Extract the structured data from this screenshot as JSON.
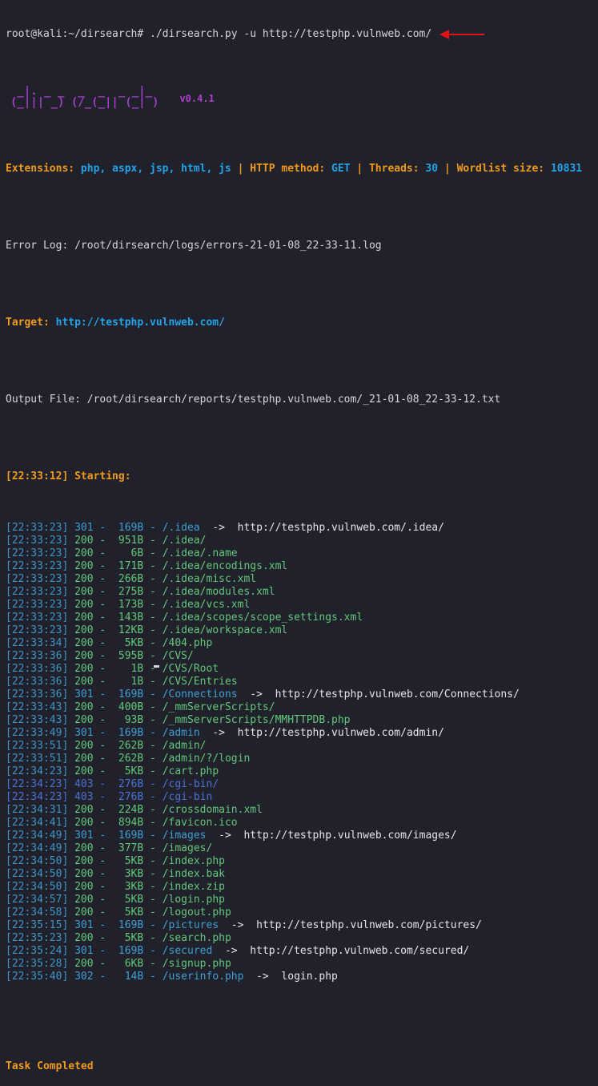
{
  "prompt": "root@kali:~/dirsearch#",
  "command": "./dirsearch.py -u http://testphp.vulnweb.com/",
  "logo_art": [
    " _|. _ _  _  _  _ _|_",
    "(_||| _) (/_(_|| (_| )"
  ],
  "version": "v0.4.1",
  "config": {
    "ext_label": "Extensions:",
    "ext_value": "php, aspx, jsp, html, js",
    "sep": "|",
    "method_label": "HTTP method:",
    "method_value": "GET",
    "threads_label": "Threads:",
    "threads_value": "30",
    "wordlist_label": "Wordlist size:",
    "wordlist_value": "10831"
  },
  "error_log": "Error Log: /root/dirsearch/logs/errors-21-01-08_22-33-11.log",
  "target_label": "Target:",
  "target_url": "http://testphp.vulnweb.com/",
  "output_file": "Output File: /root/dirsearch/reports/testphp.vulnweb.com/_21-01-08_22-33-12.txt",
  "start_line": "[22:33:12] Starting:",
  "arrow": "->",
  "dash": "-",
  "results": [
    {
      "time": "[22:33:23]",
      "status": "301",
      "size": "169B",
      "path": "/.idea",
      "redirect": "http://testphp.vulnweb.com/.idea/"
    },
    {
      "time": "[22:33:23]",
      "status": "200",
      "size": "951B",
      "path": "/.idea/"
    },
    {
      "time": "[22:33:23]",
      "status": "200",
      "size": "6B",
      "path": "/.idea/.name"
    },
    {
      "time": "[22:33:23]",
      "status": "200",
      "size": "171B",
      "path": "/.idea/encodings.xml"
    },
    {
      "time": "[22:33:23]",
      "status": "200",
      "size": "266B",
      "path": "/.idea/misc.xml"
    },
    {
      "time": "[22:33:23]",
      "status": "200",
      "size": "275B",
      "path": "/.idea/modules.xml"
    },
    {
      "time": "[22:33:23]",
      "status": "200",
      "size": "173B",
      "path": "/.idea/vcs.xml"
    },
    {
      "time": "[22:33:23]",
      "status": "200",
      "size": "143B",
      "path": "/.idea/scopes/scope_settings.xml"
    },
    {
      "time": "[22:33:23]",
      "status": "200",
      "size": "12KB",
      "path": "/.idea/workspace.xml"
    },
    {
      "time": "[22:33:34]",
      "status": "200",
      "size": "5KB",
      "path": "/404.php"
    },
    {
      "time": "[22:33:36]",
      "status": "200",
      "size": "595B",
      "path": "/CVS/"
    },
    {
      "time": "[22:33:36]",
      "status": "200",
      "size": "1B",
      "path": "/CVS/Root"
    },
    {
      "time": "[22:33:36]",
      "status": "200",
      "size": "1B",
      "path": "/CVS/Entries"
    },
    {
      "time": "[22:33:36]",
      "status": "301",
      "size": "169B",
      "path": "/Connections",
      "redirect": "http://testphp.vulnweb.com/Connections/"
    },
    {
      "time": "[22:33:43]",
      "status": "200",
      "size": "400B",
      "path": "/_mmServerScripts/"
    },
    {
      "time": "[22:33:43]",
      "status": "200",
      "size": "93B",
      "path": "/_mmServerScripts/MMHTTPDB.php"
    },
    {
      "time": "[22:33:49]",
      "status": "301",
      "size": "169B",
      "path": "/admin",
      "redirect": "http://testphp.vulnweb.com/admin/"
    },
    {
      "time": "[22:33:51]",
      "status": "200",
      "size": "262B",
      "path": "/admin/"
    },
    {
      "time": "[22:33:51]",
      "status": "200",
      "size": "262B",
      "path": "/admin/?/login"
    },
    {
      "time": "[22:34:23]",
      "status": "200",
      "size": "5KB",
      "path": "/cart.php"
    },
    {
      "time": "[22:34:23]",
      "status": "403",
      "size": "276B",
      "path": "/cgi-bin/"
    },
    {
      "time": "[22:34:23]",
      "status": "403",
      "size": "276B",
      "path": "/cgi-bin"
    },
    {
      "time": "[22:34:31]",
      "status": "200",
      "size": "224B",
      "path": "/crossdomain.xml"
    },
    {
      "time": "[22:34:41]",
      "status": "200",
      "size": "894B",
      "path": "/favicon.ico"
    },
    {
      "time": "[22:34:49]",
      "status": "301",
      "size": "169B",
      "path": "/images",
      "redirect": "http://testphp.vulnweb.com/images/"
    },
    {
      "time": "[22:34:49]",
      "status": "200",
      "size": "377B",
      "path": "/images/"
    },
    {
      "time": "[22:34:50]",
      "status": "200",
      "size": "5KB",
      "path": "/index.php"
    },
    {
      "time": "[22:34:50]",
      "status": "200",
      "size": "3KB",
      "path": "/index.bak"
    },
    {
      "time": "[22:34:50]",
      "status": "200",
      "size": "3KB",
      "path": "/index.zip"
    },
    {
      "time": "[22:34:57]",
      "status": "200",
      "size": "5KB",
      "path": "/login.php"
    },
    {
      "time": "[22:34:58]",
      "status": "200",
      "size": "5KB",
      "path": "/logout.php"
    },
    {
      "time": "[22:35:15]",
      "status": "301",
      "size": "169B",
      "path": "/pictures",
      "redirect": "http://testphp.vulnweb.com/pictures/"
    },
    {
      "time": "[22:35:23]",
      "status": "200",
      "size": "5KB",
      "path": "/search.php"
    },
    {
      "time": "[22:35:24]",
      "status": "301",
      "size": "169B",
      "path": "/secured",
      "redirect": "http://testphp.vulnweb.com/secured/"
    },
    {
      "time": "[22:35:28]",
      "status": "200",
      "size": "6KB",
      "path": "/signup.php"
    },
    {
      "time": "[22:35:40]",
      "status": "302",
      "size": "14B",
      "path": "/userinfo.php",
      "redirect": "login.php"
    }
  ],
  "task_completed": "Task Completed",
  "colors": {
    "background": "#20212b",
    "ok": "#63c87c",
    "redirect": "#3d9fd4",
    "forbidden": "#4a72d6",
    "accent_orange": "#f29a19",
    "accent_blue": "#23a3e8",
    "logo_purple": "#a13ec8",
    "annotation_arrow": "#e0131a"
  }
}
